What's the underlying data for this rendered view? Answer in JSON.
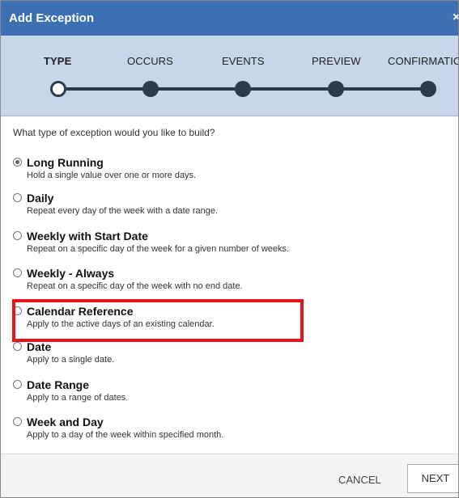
{
  "dialog": {
    "title": "Add Exception",
    "close_glyph": "×"
  },
  "wizard": {
    "steps": [
      {
        "label": "TYPE",
        "active": true
      },
      {
        "label": "OCCURS",
        "active": false
      },
      {
        "label": "EVENTS",
        "active": false
      },
      {
        "label": "PREVIEW",
        "active": false
      },
      {
        "label": "CONFIRMATIO",
        "active": false
      }
    ]
  },
  "content": {
    "question": "What type of exception would you like to build?",
    "options": [
      {
        "title": "Long Running",
        "description": "Hold a single value over one or more days.",
        "selected": true
      },
      {
        "title": "Daily",
        "description": "Repeat every day of the week with a date range.",
        "selected": false
      },
      {
        "title": "Weekly with Start Date",
        "description": "Repeat on a specific day of the week for a given number of weeks.",
        "selected": false
      },
      {
        "title": "Weekly - Always",
        "description": "Repeat on a specific day of the week with no end date.",
        "selected": false
      },
      {
        "title": "Calendar Reference",
        "description": "Apply to the active days of an existing calendar.",
        "selected": false,
        "highlighted": true
      },
      {
        "title": "Date",
        "description": "Apply to a single date.",
        "selected": false
      },
      {
        "title": "Date Range",
        "description": "Apply to a range of dates.",
        "selected": false
      },
      {
        "title": "Week and Day",
        "description": "Apply to a day of the week within specified month.",
        "selected": false
      }
    ]
  },
  "footer": {
    "cancel_label": "CANCEL",
    "next_label": "NEXT"
  },
  "colors": {
    "titlebar": "#3d6fb4",
    "wizard_bg": "#c8d6e9",
    "track": "#2c3a4d",
    "highlight": "#e8141b"
  }
}
